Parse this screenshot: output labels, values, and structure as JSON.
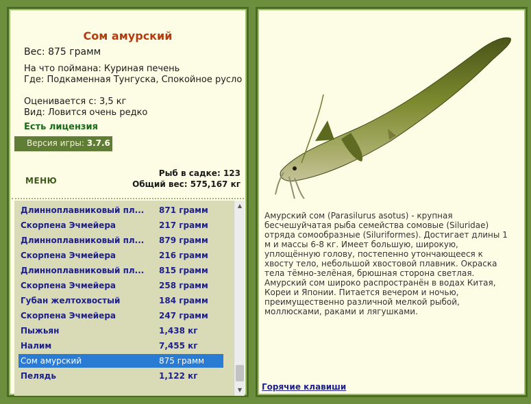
{
  "fish": {
    "name": "Сом амурский",
    "weight_label": "Вес:",
    "weight_value": "875 грамм",
    "bait_label": "На что поймана:",
    "bait_value": "Куриная печень",
    "location_label": "Где:",
    "location_value": "Подкаменная Тунгуска, Спокойное русло",
    "price_label": "Оценивается с:",
    "price_value": "3,5 кг",
    "kind_label": "Вид:",
    "kind_value": "Ловится очень редко"
  },
  "license": "Есть лицензия",
  "version": {
    "label": "Версия игры:",
    "value": "3.7.6"
  },
  "menu_label": "МЕНЮ",
  "stats": {
    "count_label": "Рыб в садке:",
    "count_value": "123",
    "total_label": "Общий вес:",
    "total_value": "575,167 кг"
  },
  "catch_list": [
    {
      "name": "Длинноплавниковый пл...",
      "weight": "871 грамм"
    },
    {
      "name": "Скорпена Эчмейера",
      "weight": "217 грамм"
    },
    {
      "name": "Длинноплавниковый пл...",
      "weight": "879 грамм"
    },
    {
      "name": "Скорпена Эчмейера",
      "weight": "216 грамм"
    },
    {
      "name": "Длинноплавниковый пл...",
      "weight": "815 грамм"
    },
    {
      "name": "Скорпена Эчмейера",
      "weight": "258 грамм"
    },
    {
      "name": "Губан желтохвостый",
      "weight": "184 грамм"
    },
    {
      "name": "Скорпена Эчмейера",
      "weight": "247 грамм"
    },
    {
      "name": "Пыжьян",
      "weight": "1,438 кг"
    },
    {
      "name": "Налим",
      "weight": "7,455 кг"
    },
    {
      "name": "Сом амурский",
      "weight": "875 грамм"
    },
    {
      "name": "Пелядь",
      "weight": "1,122 кг"
    }
  ],
  "selected_index": 10,
  "description": "Амурский сом (Parasilurus asotus) - крупная бесчешуйчатая рыба семейства сомовые (Siluridae) отряда сомообразные (Siluriformes). Достигает длины 1 м и массы 6-8 кг. Имеет большую, широкую, уплощённую голову, постепенно утончающееся к хвосту тело, небольшой хвостовой плавник. Окраска тела тёмно-зелёная, брюшная сторона светлая. Амурский сом широко распространён в водах Китая, Кореи и Японии. Питается вечером и ночью, преимущественно различной мелкой рыбой, моллюсками, раками и лягушками.",
  "hotkeys_link": "Горячие клавиши",
  "colors": {
    "background": "#6b8f3c",
    "panel": "#fdfde6",
    "title": "#b33d0f",
    "list_text": "#1d1f8a",
    "selected": "#2a7bd4",
    "license": "#1a6a1a"
  }
}
